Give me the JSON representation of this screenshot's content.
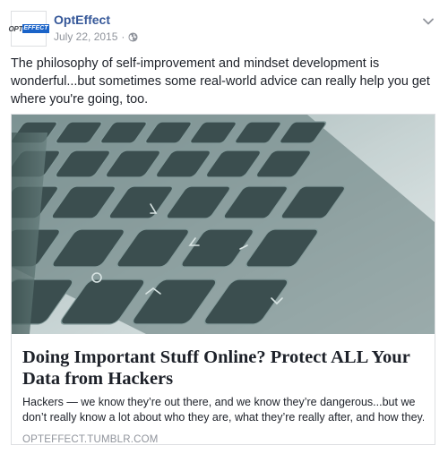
{
  "post": {
    "page_name": "OptEffect",
    "timestamp": "July 22, 2015",
    "separator": "·",
    "privacy_icon": "globe-icon",
    "menu_icon": "chevron-down-icon",
    "text": "The philosophy of self-improvement and mindset development is wonderful...but sometimes some real-world advice can really help you get where you're going, too."
  },
  "avatar": {
    "logo_part1": "OPT",
    "logo_part2": "EFFECT"
  },
  "link_card": {
    "image_icon": "keyboard-photo",
    "title": "Doing Important Stuff Online? Protect ALL Your Data from Hackers",
    "description_line1": "Hackers — we know they’re out there, and we know they’re dangerous...but we",
    "description_line2": "don’t really know a lot about who they are, what they’re really after, and how they...",
    "domain": "OPTEFFECT.TUMBLR.COM"
  },
  "colors": {
    "link_blue": "#365899",
    "meta_gray": "#90949c",
    "text": "#1d2129",
    "border": "#dddfe2",
    "logo_blue": "#1a63c8"
  }
}
